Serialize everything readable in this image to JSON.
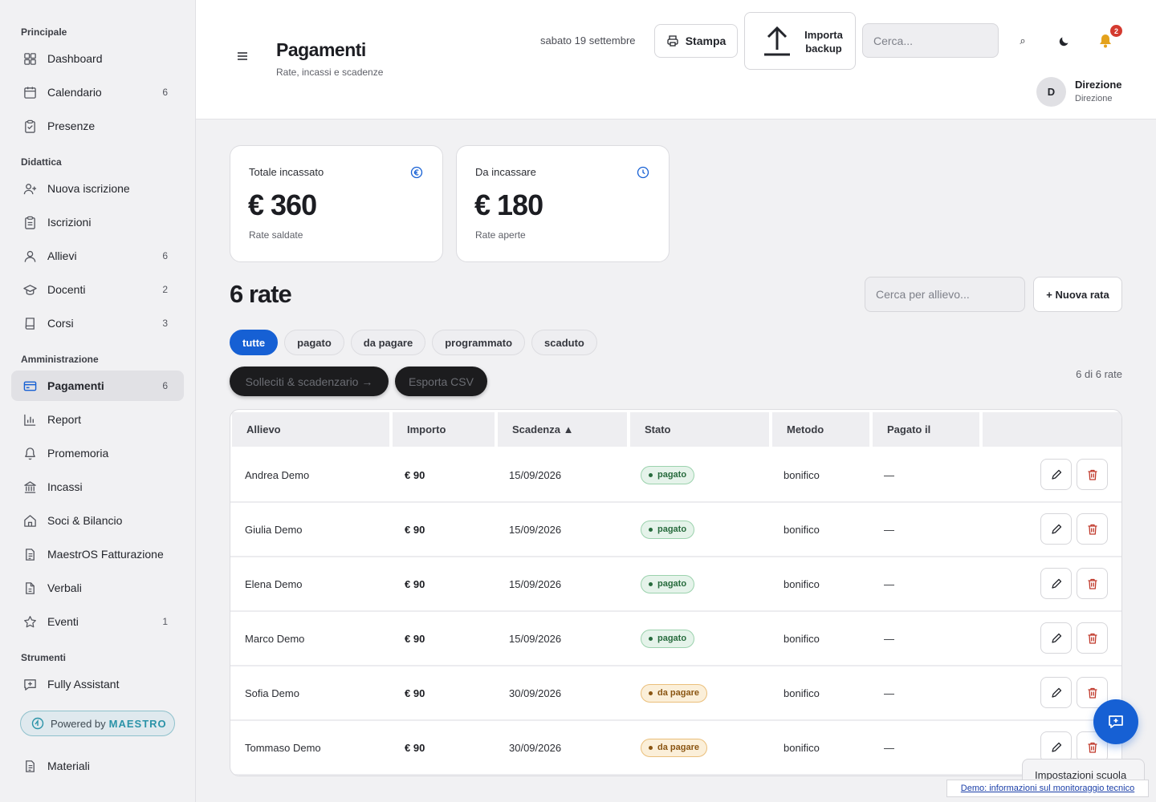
{
  "sidebar": {
    "sections": [
      {
        "title": "Principale",
        "items": [
          {
            "label": "Dashboard",
            "icon": "grid-icon",
            "count": ""
          },
          {
            "label": "Calendario",
            "icon": "calendar-icon",
            "count": "6"
          },
          {
            "label": "Presenze",
            "icon": "clipboard-check-icon",
            "count": ""
          }
        ]
      },
      {
        "title": "Didattica",
        "items": [
          {
            "label": "Nuova iscrizione",
            "icon": "user-plus-icon",
            "count": ""
          },
          {
            "label": "Iscrizioni",
            "icon": "clipboard-icon",
            "count": ""
          },
          {
            "label": "Allievi",
            "icon": "user-icon",
            "count": "6"
          },
          {
            "label": "Docenti",
            "icon": "graduation-cap-icon",
            "count": "2"
          },
          {
            "label": "Corsi",
            "icon": "book-icon",
            "count": "3"
          }
        ]
      },
      {
        "title": "Amministrazione",
        "items": [
          {
            "label": "Pagamenti",
            "icon": "credit-card-icon",
            "count": "6"
          },
          {
            "label": "Report",
            "icon": "bar-chart-icon",
            "count": ""
          },
          {
            "label": "Promemoria",
            "icon": "bell-icon",
            "count": ""
          },
          {
            "label": "Incassi",
            "icon": "bank-icon",
            "count": ""
          },
          {
            "label": "Soci & Bilancio",
            "icon": "home-icon",
            "count": ""
          },
          {
            "label": "MaestrOS Fatturazione",
            "icon": "document-icon",
            "count": ""
          },
          {
            "label": "Verbali",
            "icon": "file-text-icon",
            "count": ""
          },
          {
            "label": "Eventi",
            "icon": "star-icon",
            "count": "1"
          }
        ]
      },
      {
        "title": "Strumenti",
        "items": [
          {
            "label": "Fully Assistant",
            "icon": "chat-plus-icon",
            "count": ""
          }
        ]
      }
    ],
    "powered_prefix": "Powered by",
    "powered_brand": "MAESTRO",
    "after_powered": {
      "label": "Materiali",
      "icon": "document-icon"
    }
  },
  "header": {
    "title": "Pagamenti",
    "subtitle": "Rate, incassi e scadenze",
    "date": "sabato 19 settembre",
    "print_label": "Stampa",
    "import_label": "Importa backup",
    "search_placeholder": "Cerca...",
    "search_icon_glyph": "⌕",
    "notifications_count": "2",
    "user_initial": "D",
    "user_name": "Direzione",
    "user_role": "Direzione"
  },
  "stats": [
    {
      "title": "Totale incassato",
      "value": "€ 360",
      "sub": "Rate saldate",
      "icon": "euro-icon"
    },
    {
      "title": "Da incassare",
      "value": "€ 180",
      "sub": "Rate aperte",
      "icon": "clock-icon"
    }
  ],
  "rates": {
    "title": "6 rate",
    "search_placeholder": "Cerca per allievo...",
    "new_button": "+ Nuova rata",
    "filters": [
      "tutte",
      "pagato",
      "da pagare",
      "programmato",
      "scaduto"
    ],
    "active_filter": "tutte",
    "reminders_button": "Solleciti & scadenzario →",
    "export_button": "Esporta CSV",
    "count_label": "6 di 6 rate",
    "columns": [
      "Allievo",
      "Importo",
      "Scadenza ▲",
      "Stato",
      "Metodo",
      "Pagato il",
      ""
    ],
    "rows": [
      {
        "student": "Andrea Demo",
        "amount": "€ 90",
        "due": "15/09/2026",
        "status": "pagato",
        "status_kind": "paid",
        "method": "bonifico",
        "paid_on": "—"
      },
      {
        "student": "Giulia Demo",
        "amount": "€ 90",
        "due": "15/09/2026",
        "status": "pagato",
        "status_kind": "paid",
        "method": "bonifico",
        "paid_on": "—"
      },
      {
        "student": "Elena Demo",
        "amount": "€ 90",
        "due": "15/09/2026",
        "status": "pagato",
        "status_kind": "paid",
        "method": "bonifico",
        "paid_on": "—"
      },
      {
        "student": "Marco Demo",
        "amount": "€ 90",
        "due": "15/09/2026",
        "status": "pagato",
        "status_kind": "paid",
        "method": "bonifico",
        "paid_on": "—"
      },
      {
        "student": "Sofia Demo",
        "amount": "€ 90",
        "due": "30/09/2026",
        "status": "da pagare",
        "status_kind": "due",
        "method": "bonifico",
        "paid_on": "—"
      },
      {
        "student": "Tommaso Demo",
        "amount": "€ 90",
        "due": "30/09/2026",
        "status": "da pagare",
        "status_kind": "due",
        "method": "bonifico",
        "paid_on": "—"
      }
    ]
  },
  "footer": {
    "settings_label": "Impostazioni scuola",
    "demo_link": "Demo: informazioni sul monitoraggio tecnico"
  },
  "colors": {
    "accent": "#1660d4",
    "paid": "#276b3d",
    "due": "#8a5512",
    "danger": "#c0392b",
    "notification": "#d43a2f",
    "bell": "#e4a21c"
  }
}
